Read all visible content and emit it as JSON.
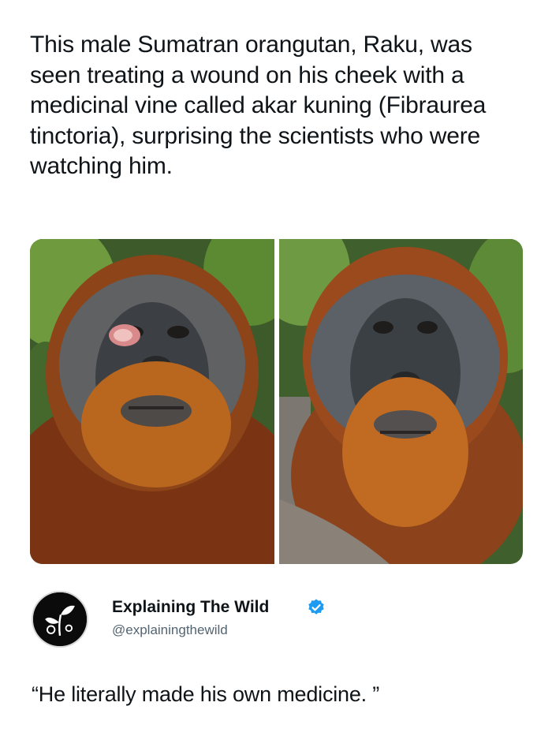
{
  "post": {
    "text": "This male Sumatran orangutan, Raku, was seen treating a wound on his cheek with a medicinal vine called akar kuning (Fibraurea tinctoria), surprising the scientists who were watching him."
  },
  "media": {
    "images": [
      {
        "subject": "orangutan-with-cheek-wound"
      },
      {
        "subject": "orangutan-healed-cheek"
      }
    ]
  },
  "author": {
    "display_name": "Explaining The Wild",
    "handle": "@explainingthewild",
    "verified": true,
    "verified_color": "#1d9bf0"
  },
  "quote": {
    "text": "“He literally made his own medicine. ”"
  }
}
